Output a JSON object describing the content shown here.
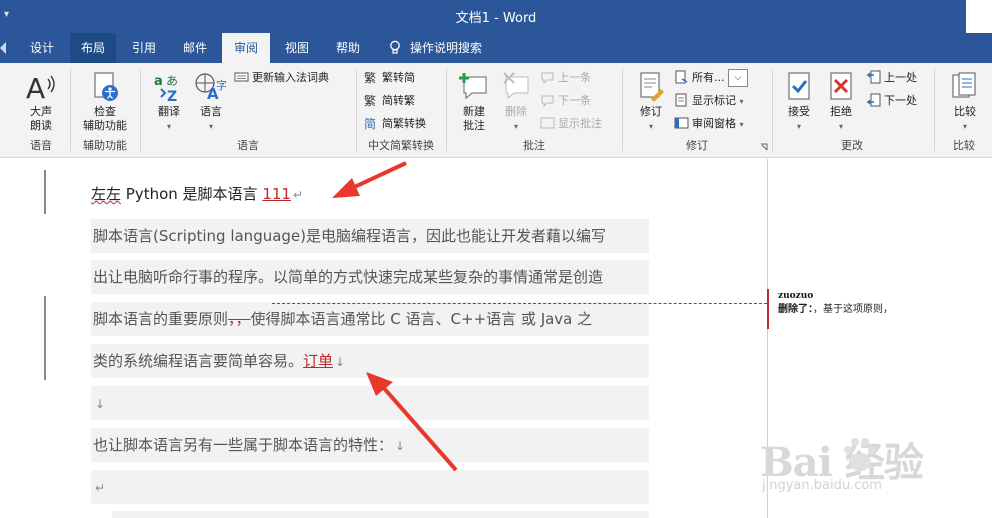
{
  "title_bar": {
    "quick_access": "▾",
    "title": "文档1  -  Word"
  },
  "tabs": [
    {
      "label": "设计"
    },
    {
      "label": "布局"
    },
    {
      "label": "引用"
    },
    {
      "label": "邮件"
    },
    {
      "label": "审阅"
    },
    {
      "label": "视图"
    },
    {
      "label": "帮助"
    }
  ],
  "tell_me": "操作说明搜索",
  "ribbon": {
    "speech": {
      "label": "语音",
      "read_aloud": "大声\n朗读"
    },
    "accessibility": {
      "label": "辅助功能",
      "check": "检查\n辅助功能"
    },
    "language": {
      "label": "语言",
      "translate": "翻译",
      "language": "语言",
      "update_ime": "更新输入法词典"
    },
    "chinese": {
      "label": "中文简繁转换",
      "to_simplified": "繁转简",
      "to_traditional": "简转繁",
      "convert": "简繁转换"
    },
    "comments": {
      "label": "批注",
      "new": "新建\n批注",
      "delete": "删除",
      "previous": "上一条",
      "next": "下一条",
      "show": "显示批注"
    },
    "tracking": {
      "label": "修订",
      "track": "修订",
      "markup_dropdown": "所有...",
      "show_markup": "显示标记",
      "reviewing_pane": "审阅窗格"
    },
    "changes": {
      "label": "更改",
      "accept": "接受",
      "reject": "拒绝",
      "previous": "上一处",
      "next": "下一处"
    },
    "compare": {
      "label": "比较",
      "compare": "比较"
    }
  },
  "document": {
    "line1": {
      "squiggly": "左左",
      "text": " Python 是脚本语言 ",
      "inserted": "111",
      "mark": "↵"
    },
    "p1": "脚本语言(Scripting language)是电脑编程语言，因此也能让开发者藉以编写",
    "p2": "出让电脑听命行事的程序。以简单的方式快速完成某些复杂的事情通常是创造",
    "p3": {
      "before": "脚本语言的重要原则",
      "deleted": "，，",
      "after": "使得脚本语言通常比 C 语言、C++语言 或 Java 之"
    },
    "p4": {
      "before": "类的系统编程语言要简单容易。",
      "inserted": "订单",
      "mark": "↓"
    },
    "p5": {
      "mark": "↓"
    },
    "p6": {
      "text": "也让脚本语言另有一些属于脚本语言的特性：",
      "mark": "↓"
    },
    "p7": {
      "mark": "↵"
    }
  },
  "comment": {
    "author": "zuozuo",
    "action": "删除了：",
    "content": "，基于这项原则，"
  },
  "watermark": {
    "logo": "Bai 经验",
    "url": "jingyan.baidu.com"
  },
  "colors": {
    "accent": "#2b579a",
    "revision": "#c0282d",
    "arrow": "#e8382e"
  }
}
